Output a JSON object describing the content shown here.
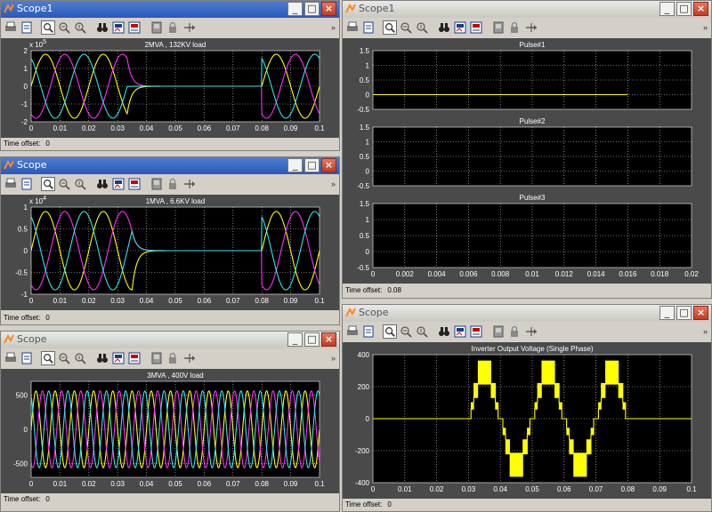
{
  "windows": [
    {
      "id": "w1",
      "title": "Scope1",
      "active": true,
      "time_offset_label": "Time offset:",
      "time_offset": "0"
    },
    {
      "id": "w2",
      "title": "Scope",
      "active": true,
      "time_offset_label": "Time offset:",
      "time_offset": "0"
    },
    {
      "id": "w3",
      "title": "Scope",
      "active": false,
      "time_offset_label": "Time offset:",
      "time_offset": "0"
    },
    {
      "id": "w4",
      "title": "Scope1",
      "active": false,
      "time_offset_label": "Time offset:",
      "time_offset": "0.08"
    },
    {
      "id": "w5",
      "title": "Scope",
      "active": false,
      "time_offset_label": "Time offset:",
      "time_offset": "0"
    }
  ],
  "toolbar_icons": [
    "print-icon",
    "params-icon",
    "zoom-icon",
    "zoom-x-icon",
    "zoom-y-icon",
    "binoculars-icon",
    "save-axes-icon",
    "restore-axes-icon",
    "floating-scope-icon",
    "lock-icon",
    "signal-select-icon"
  ],
  "colors": {
    "yellow": "#ffff00",
    "magenta": "#ff2dff",
    "cyan": "#33e6e6",
    "plot_bg": "#000000",
    "frame_bg": "#4a4a4a",
    "grid": "#cfcfcf"
  },
  "chart_data": [
    {
      "id": "c1",
      "type": "line",
      "title": "2MVA , 132KV load",
      "exponent": "5",
      "xlim": [
        0,
        0.1
      ],
      "ylim": [
        -2,
        2
      ],
      "xticks": [
        0,
        0.01,
        0.02,
        0.03,
        0.04,
        0.05,
        0.06,
        0.07,
        0.08,
        0.09,
        0.1
      ],
      "yticks": [
        -2,
        -1,
        0,
        1,
        2
      ],
      "xtick_labels": [
        "0",
        "0.01",
        "0.02",
        "0.03",
        "0.04",
        "0.05",
        "0.06",
        "0.07",
        "0.08",
        "0.09",
        "0.1"
      ],
      "ytick_labels": [
        "-2",
        "-1",
        "0",
        "1",
        "2"
      ],
      "wave": {
        "kind": "three_phase",
        "freq": 50,
        "amp": 1.8,
        "fault_start": 0.0333,
        "fault_end": 0.08,
        "fault_level": 0
      },
      "series": [
        {
          "color": "yellow",
          "phase": 0
        },
        {
          "color": "magenta",
          "phase": -120
        },
        {
          "color": "cyan",
          "phase": 120
        }
      ]
    },
    {
      "id": "c2",
      "type": "line",
      "title": "1MVA , 6.6KV load",
      "exponent": "4",
      "xlim": [
        0,
        0.1
      ],
      "ylim": [
        -1,
        1
      ],
      "xticks": [
        0,
        0.01,
        0.02,
        0.03,
        0.04,
        0.05,
        0.06,
        0.07,
        0.08,
        0.09,
        0.1
      ],
      "yticks": [
        -1,
        -0.5,
        0,
        0.5,
        1
      ],
      "xtick_labels": [
        "0",
        "0.01",
        "0.02",
        "0.03",
        "0.04",
        "0.05",
        "0.06",
        "0.07",
        "0.08",
        "0.09",
        "0.1"
      ],
      "ytick_labels": [
        "-1",
        "-0.5",
        "0",
        "0.5",
        "1"
      ],
      "wave": {
        "kind": "three_phase",
        "freq": 50,
        "amp": 0.9,
        "fault_start": 0.035,
        "fault_end": 0.08,
        "fault_level": 0
      },
      "series": [
        {
          "color": "yellow",
          "phase": 0
        },
        {
          "color": "magenta",
          "phase": -120
        },
        {
          "color": "cyan",
          "phase": 120
        }
      ]
    },
    {
      "id": "c3",
      "type": "line",
      "title": "3MVA , 400V load",
      "xlim": [
        0,
        0.1
      ],
      "ylim": [
        -700,
        700
      ],
      "xticks": [
        0,
        0.01,
        0.02,
        0.03,
        0.04,
        0.05,
        0.06,
        0.07,
        0.08,
        0.09,
        0.1
      ],
      "yticks": [
        -500,
        0,
        500
      ],
      "xtick_labels": [
        "0",
        "0.01",
        "0.02",
        "0.03",
        "0.04",
        "0.05",
        "0.06",
        "0.07",
        "0.08",
        "0.09",
        "0.1"
      ],
      "ytick_labels": [
        "-500",
        "0",
        "500"
      ],
      "wave": {
        "kind": "three_phase",
        "freq": 150,
        "amp": 560
      },
      "series": [
        {
          "color": "yellow",
          "phase": 0
        },
        {
          "color": "magenta",
          "phase": -120
        },
        {
          "color": "cyan",
          "phase": 120
        }
      ]
    },
    {
      "id": "c4a",
      "type": "line",
      "title": "Pulse#1",
      "xlim": [
        0,
        0.02
      ],
      "ylim": [
        -0.5,
        1.5
      ],
      "xticks": [
        0,
        0.002,
        0.004,
        0.006,
        0.008,
        0.01,
        0.012,
        0.014,
        0.016,
        0.018,
        0.02
      ],
      "yticks": [
        -0.5,
        0,
        0.5,
        1,
        1.5
      ],
      "xtick_labels": [],
      "ytick_labels": [
        "-0.5",
        "0",
        "0.5",
        "1",
        "1.5"
      ],
      "wave": {
        "kind": "flat",
        "level": 0,
        "x_end": 0.016
      },
      "series": [
        {
          "color": "yellow"
        }
      ]
    },
    {
      "id": "c4b",
      "type": "line",
      "title": "Pulse#2",
      "xlim": [
        0,
        0.02
      ],
      "ylim": [
        -0.5,
        1.5
      ],
      "xticks": [
        0,
        0.002,
        0.004,
        0.006,
        0.008,
        0.01,
        0.012,
        0.014,
        0.016,
        0.018,
        0.02
      ],
      "yticks": [
        -0.5,
        0,
        0.5,
        1,
        1.5
      ],
      "xtick_labels": [],
      "ytick_labels": [
        "-0.5",
        "0",
        "0.5",
        "1",
        "1.5"
      ],
      "wave": {
        "kind": "none"
      },
      "series": []
    },
    {
      "id": "c4c",
      "type": "line",
      "title": "Pulse#3",
      "xlim": [
        0,
        0.02
      ],
      "ylim": [
        -0.5,
        1.5
      ],
      "xticks": [
        0,
        0.002,
        0.004,
        0.006,
        0.008,
        0.01,
        0.012,
        0.014,
        0.016,
        0.018,
        0.02
      ],
      "yticks": [
        -0.5,
        0,
        0.5,
        1,
        1.5
      ],
      "xtick_labels": [
        "0",
        "0.002",
        "0.004",
        "0.006",
        "0.008",
        "0.01",
        "0.012",
        "0.014",
        "0.016",
        "0.018",
        "0.02"
      ],
      "ytick_labels": [
        "-0.5",
        "0",
        "0.5",
        "1",
        "1.5"
      ],
      "wave": {
        "kind": "none"
      },
      "series": []
    },
    {
      "id": "c5",
      "type": "line",
      "title": "Inverter Output Voltage (Single Phase)",
      "xlim": [
        0,
        0.1
      ],
      "ylim": [
        -400,
        400
      ],
      "xticks": [
        0,
        0.01,
        0.02,
        0.03,
        0.04,
        0.05,
        0.06,
        0.07,
        0.08,
        0.09,
        0.1
      ],
      "yticks": [
        -400,
        -200,
        0,
        200,
        400
      ],
      "xtick_labels": [
        "0",
        "0.01",
        "0.02",
        "0.03",
        "0.04",
        "0.05",
        "0.06",
        "0.07",
        "0.08",
        "0.09",
        "0.1"
      ],
      "ytick_labels": [
        "-400",
        "-200",
        "0",
        "200",
        "400"
      ],
      "wave": {
        "kind": "multilevel",
        "freq": 50,
        "start": 0.03,
        "end": 0.08,
        "levels": [
          100,
          220,
          360
        ],
        "amp": 380
      },
      "series": [
        {
          "color": "yellow"
        }
      ]
    }
  ]
}
